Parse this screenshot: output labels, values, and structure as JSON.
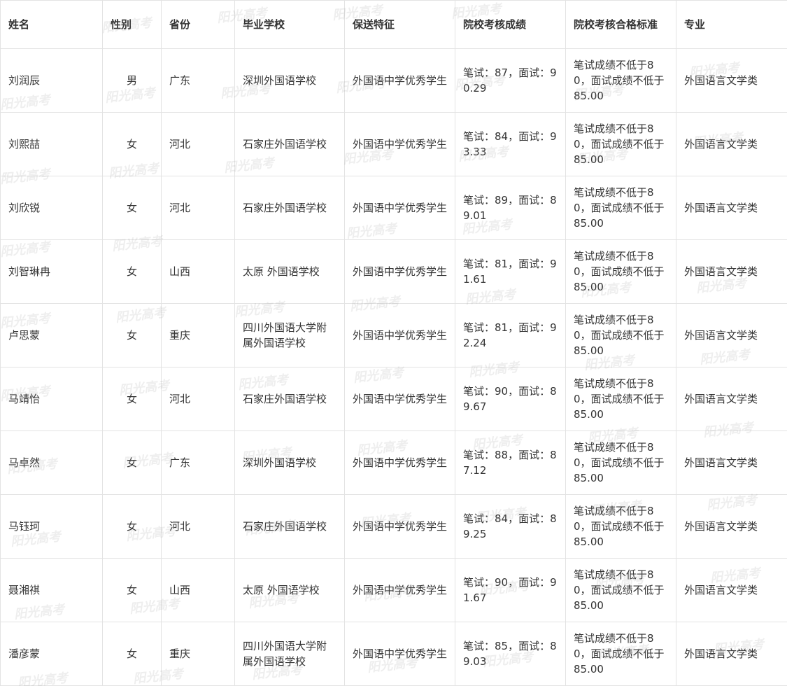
{
  "table": {
    "headers": [
      "姓名",
      "性别",
      "省份",
      "毕业学校",
      "保送特征",
      "院校考核成绩",
      "院校考核合格标准",
      "专业"
    ],
    "rows": [
      [
        "刘润辰",
        "男",
        "广东",
        "深圳外国语学校",
        "外国语中学优秀学生",
        "笔试：87，面试：90.29",
        "笔试成绩不低于80，面试成绩不低于85.00",
        "外国语言文学类"
      ],
      [
        "刘熙喆",
        "女",
        "河北",
        "石家庄外国语学校",
        "外国语中学优秀学生",
        "笔试：84，面试：93.33",
        "笔试成绩不低于80，面试成绩不低于85.00",
        "外国语言文学类"
      ],
      [
        "刘欣锐",
        "女",
        "河北",
        "石家庄外国语学校",
        "外国语中学优秀学生",
        "笔试：89，面试：89.01",
        "笔试成绩不低于80，面试成绩不低于85.00",
        "外国语言文学类"
      ],
      [
        "刘智琳冉",
        "女",
        "山西",
        "太原 外国语学校",
        "外国语中学优秀学生",
        "笔试：81，面试：91.61",
        "笔试成绩不低于80，面试成绩不低于85.00",
        "外国语言文学类"
      ],
      [
        "卢思蒙",
        "女",
        "重庆",
        "四川外国语大学附属外国语学校",
        "外国语中学优秀学生",
        "笔试：81，面试：92.24",
        "笔试成绩不低于80，面试成绩不低于85.00",
        "外国语言文学类"
      ],
      [
        "马靖怡",
        "女",
        "河北",
        "石家庄外国语学校",
        "外国语中学优秀学生",
        "笔试：90，面试：89.67",
        "笔试成绩不低于80，面试成绩不低于85.00",
        "外国语言文学类"
      ],
      [
        "马卓然",
        "女",
        "广东",
        "深圳外国语学校",
        "外国语中学优秀学生",
        "笔试：88，面试：87.12",
        "笔试成绩不低于80，面试成绩不低于85.00",
        "外国语言文学类"
      ],
      [
        "马钰珂",
        "女",
        "河北",
        "石家庄外国语学校",
        "外国语中学优秀学生",
        "笔试：84，面试：89.25",
        "笔试成绩不低于80，面试成绩不低于85.00",
        "外国语言文学类"
      ],
      [
        "聂湘祺",
        "女",
        "山西",
        "太原 外国语学校",
        "外国语中学优秀学生",
        "笔试：90，面试：91.67",
        "笔试成绩不低于80，面试成绩不低于85.00",
        "外国语言文学类"
      ],
      [
        "潘彦蒙",
        "女",
        "重庆",
        "四川外国语大学附属外国语学校",
        "外国语中学优秀学生",
        "笔试：85，面试：89.03",
        "笔试成绩不低于80，面试成绩不低于85.00",
        "外国语言文学类"
      ]
    ]
  },
  "watermark": {
    "text": "阳光高考"
  }
}
